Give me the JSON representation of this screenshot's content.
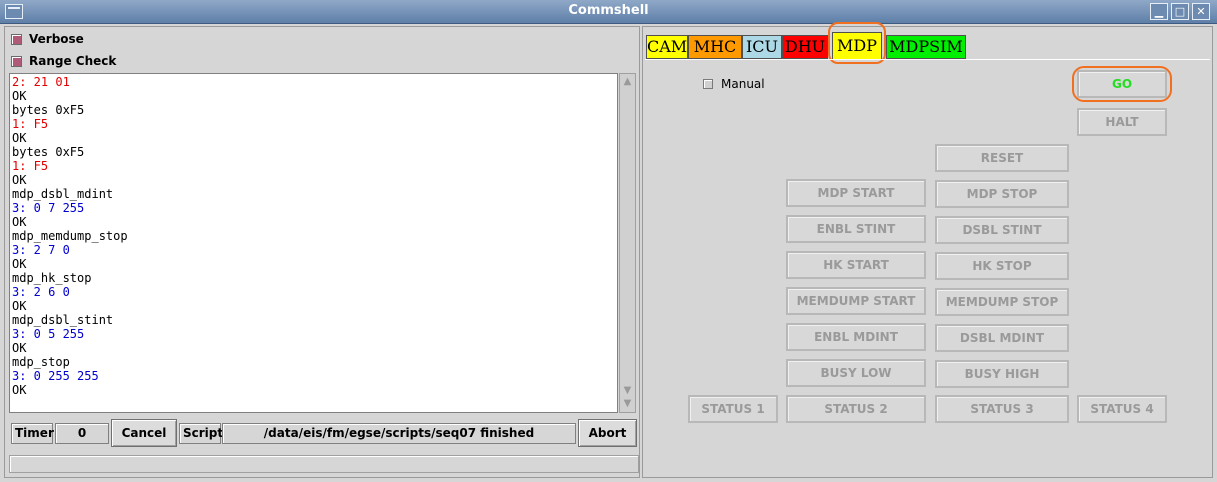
{
  "window": {
    "title": "Commshell"
  },
  "options": {
    "verbose_label": "Verbose",
    "range_check_label": "Range Check"
  },
  "console": {
    "lines": [
      {
        "text": "2: 21 01",
        "color": "red"
      },
      {
        "text": "OK",
        "color": "black"
      },
      {
        "text": "bytes 0xF5",
        "color": "black"
      },
      {
        "text": "1: F5",
        "color": "red"
      },
      {
        "text": "OK",
        "color": "black"
      },
      {
        "text": "bytes 0xF5",
        "color": "black"
      },
      {
        "text": "1: F5",
        "color": "red"
      },
      {
        "text": "OK",
        "color": "black"
      },
      {
        "text": "mdp_dsbl_mdint",
        "color": "black"
      },
      {
        "text": "3: 0 7 255",
        "color": "blue"
      },
      {
        "text": "OK",
        "color": "black"
      },
      {
        "text": "mdp_memdump_stop",
        "color": "black"
      },
      {
        "text": "3: 2 7 0",
        "color": "blue"
      },
      {
        "text": "OK",
        "color": "black"
      },
      {
        "text": "mdp_hk_stop",
        "color": "black"
      },
      {
        "text": "3: 2 6 0",
        "color": "blue"
      },
      {
        "text": "OK",
        "color": "black"
      },
      {
        "text": "mdp_dsbl_stint",
        "color": "black"
      },
      {
        "text": "3: 0 5 255",
        "color": "blue"
      },
      {
        "text": "OK",
        "color": "black"
      },
      {
        "text": "mdp_stop",
        "color": "black"
      },
      {
        "text": "3: 0 255 255",
        "color": "blue"
      },
      {
        "text": "OK",
        "color": "black"
      }
    ]
  },
  "bottom": {
    "timer_label": "Timer",
    "timer_value": "0",
    "cancel_label": "Cancel",
    "script_label": "Script",
    "script_status": "/data/eis/fm/egse/scripts/seq07 finished",
    "abort_label": "Abort"
  },
  "tabs": [
    {
      "label": "CAM",
      "color": "#ffff00"
    },
    {
      "label": "MHC",
      "color": "#ff9900"
    },
    {
      "label": "ICU",
      "color": "#add8e6"
    },
    {
      "label": "DHU",
      "color": "#ff0000"
    },
    {
      "label": "MDP",
      "color": "#ffff00"
    },
    {
      "label": "MDPSIM",
      "color": "#00ee00"
    }
  ],
  "mdp": {
    "manual_label": "Manual",
    "go": "GO",
    "halt": "HALT",
    "reset": "RESET",
    "mdp_start": "MDP START",
    "mdp_stop": "MDP STOP",
    "enbl_stint": "ENBL STINT",
    "dsbl_stint": "DSBL STINT",
    "hk_start": "HK START",
    "hk_stop": "HK STOP",
    "memdump_start": "MEMDUMP START",
    "memdump_stop": "MEMDUMP STOP",
    "enbl_mdint": "ENBL MDINT",
    "dsbl_mdint": "DSBL MDINT",
    "busy_low": "BUSY LOW",
    "busy_high": "BUSY HIGH",
    "status1": "STATUS 1",
    "status2": "STATUS 2",
    "status3": "STATUS 3",
    "status4": "STATUS 4"
  },
  "colors": {
    "highlight_ring": "#f07020",
    "go_text": "#22dd22",
    "disabled_text": "#9a9a9a"
  }
}
